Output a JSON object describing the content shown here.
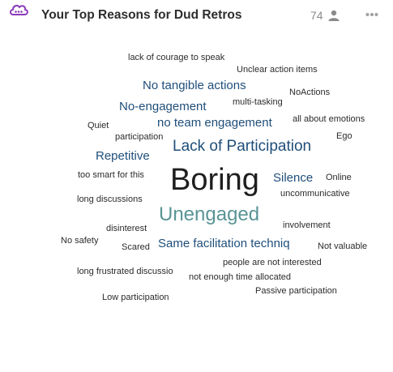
{
  "header": {
    "title": "Your Top Reasons for Dud Retros",
    "participant_count": "74",
    "logo_icon": "cloud-chat-logo-icon",
    "person_icon": "person-icon",
    "more_icon": "more-horizontal-icon",
    "logo_color": "#8a3ab9"
  },
  "word_cloud": {
    "words": [
      {
        "text": "lack of courage to speak"
      },
      {
        "text": "Unclear action items"
      },
      {
        "text": "No tangible actions"
      },
      {
        "text": "NoActions"
      },
      {
        "text": "multi-tasking"
      },
      {
        "text": "No-engagement"
      },
      {
        "text": "all about emotions"
      },
      {
        "text": "Quiet"
      },
      {
        "text": "no team engagement"
      },
      {
        "text": "participation"
      },
      {
        "text": "Ego"
      },
      {
        "text": "Lack of Participation"
      },
      {
        "text": "Repetitive"
      },
      {
        "text": "too smart for this"
      },
      {
        "text": "Boring"
      },
      {
        "text": "Silence"
      },
      {
        "text": "Online"
      },
      {
        "text": "uncommunicative"
      },
      {
        "text": "long discussions"
      },
      {
        "text": "Unengaged"
      },
      {
        "text": "disinterest"
      },
      {
        "text": "involvement"
      },
      {
        "text": "No safety"
      },
      {
        "text": "Scared"
      },
      {
        "text": "Same facilitation techniq"
      },
      {
        "text": "Not valuable"
      },
      {
        "text": "people are not interested"
      },
      {
        "text": "long frustrated discussio"
      },
      {
        "text": "not enough time allocated"
      },
      {
        "text": "Passive participation"
      },
      {
        "text": "Low participation"
      }
    ]
  }
}
